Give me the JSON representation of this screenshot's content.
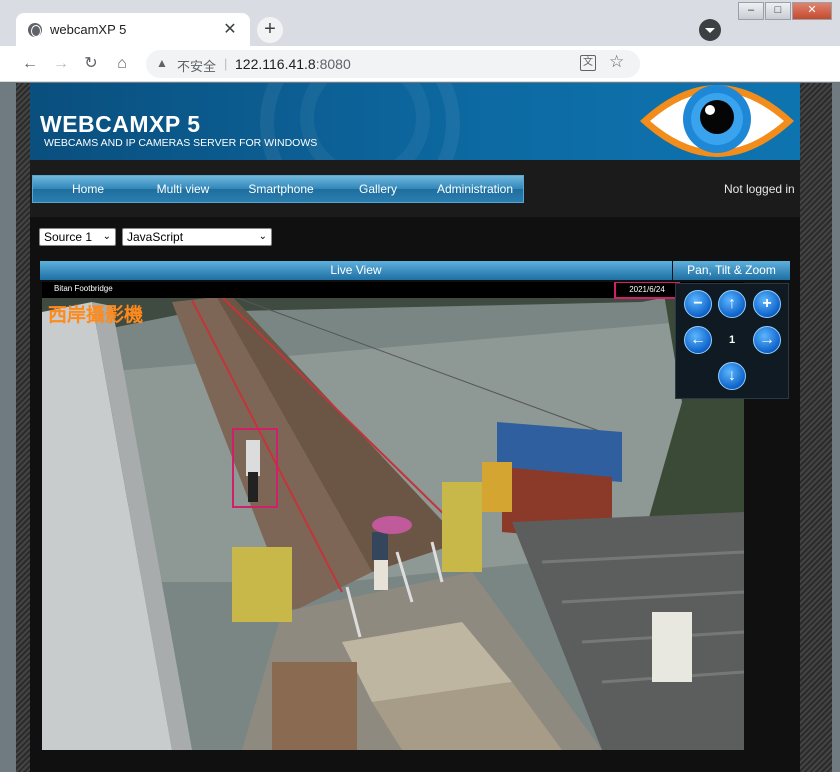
{
  "browser": {
    "tab_title": "webcamXP 5",
    "tab_close": "✕",
    "new_tab": "+",
    "security_label": "不安全",
    "url_host": "122.116.41.8",
    "url_port": ":8080",
    "window_buttons": {
      "minimize": "–",
      "maximize": "□",
      "close": "✕"
    }
  },
  "header": {
    "title": "WEBCAMXP 5",
    "tagline": "WEBCAMS AND IP CAMERAS SERVER FOR WINDOWS"
  },
  "nav": {
    "items": [
      "Home",
      "Multi view",
      "Smartphone",
      "Gallery",
      "Administration"
    ],
    "login_status": "Not logged in"
  },
  "controls": {
    "source_select": "Source 1",
    "mode_select": "JavaScript"
  },
  "live_view": {
    "header": "Live View",
    "camera_label": "Bitan Footbridge",
    "date": "2021/6/24",
    "watermark": "西岸攝影機"
  },
  "ptz": {
    "header": "Pan, Tilt & Zoom",
    "step": "1"
  },
  "colors": {
    "accent": "#1e6fa3",
    "highlight_box": "#d0206a",
    "watermark": "#ff8a1c"
  }
}
